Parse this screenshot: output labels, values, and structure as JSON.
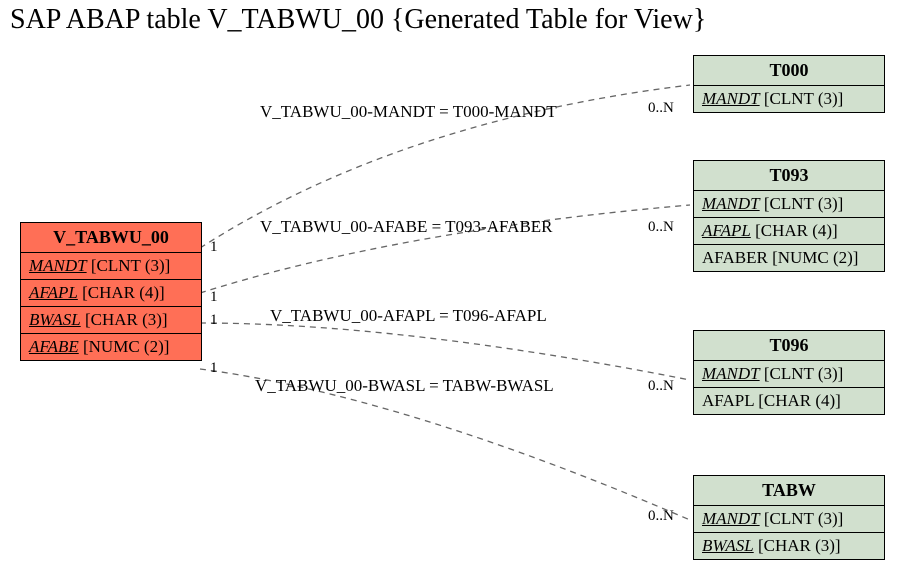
{
  "title": "SAP ABAP table V_TABWU_00 {Generated Table for View}",
  "mainEntity": {
    "name": "V_TABWU_00",
    "fields": [
      {
        "name": "MANDT",
        "type": "[CLNT (3)]",
        "pk": true
      },
      {
        "name": "AFAPL",
        "type": "[CHAR (4)]",
        "pk": true
      },
      {
        "name": "BWASL",
        "type": "[CHAR (3)]",
        "pk": true
      },
      {
        "name": "AFABE",
        "type": "[NUMC (2)]",
        "pk": true
      }
    ]
  },
  "targets": [
    {
      "name": "T000",
      "fields": [
        {
          "name": "MANDT",
          "type": "[CLNT (3)]",
          "pk": true
        }
      ]
    },
    {
      "name": "T093",
      "fields": [
        {
          "name": "MANDT",
          "type": "[CLNT (3)]",
          "pk": true
        },
        {
          "name": "AFAPL",
          "type": "[CHAR (4)]",
          "pk": true
        },
        {
          "name": "AFABER",
          "type": "[NUMC (2)]",
          "pk": false
        }
      ]
    },
    {
      "name": "T096",
      "fields": [
        {
          "name": "MANDT",
          "type": "[CLNT (3)]",
          "pk": true
        },
        {
          "name": "AFAPL",
          "type": "[CHAR (4)]",
          "pk": false
        }
      ]
    },
    {
      "name": "TABW",
      "fields": [
        {
          "name": "MANDT",
          "type": "[CLNT (3)]",
          "pk": true
        },
        {
          "name": "BWASL",
          "type": "[CHAR (3)]",
          "pk": true
        }
      ]
    }
  ],
  "edges": [
    {
      "label": "V_TABWU_00-MANDT = T000-MANDT",
      "leftCard": "1",
      "rightCard": "0..N"
    },
    {
      "label": "V_TABWU_00-AFABE = T093-AFABER",
      "leftCard": "1",
      "rightCard": "0..N"
    },
    {
      "label": "V_TABWU_00-AFAPL = T096-AFAPL",
      "leftCard": "1",
      "rightCard": ""
    },
    {
      "label": "V_TABWU_00-BWASL = TABW-BWASL",
      "leftCard": "1",
      "rightCard": "0..N"
    }
  ],
  "extraCard": "0..N"
}
